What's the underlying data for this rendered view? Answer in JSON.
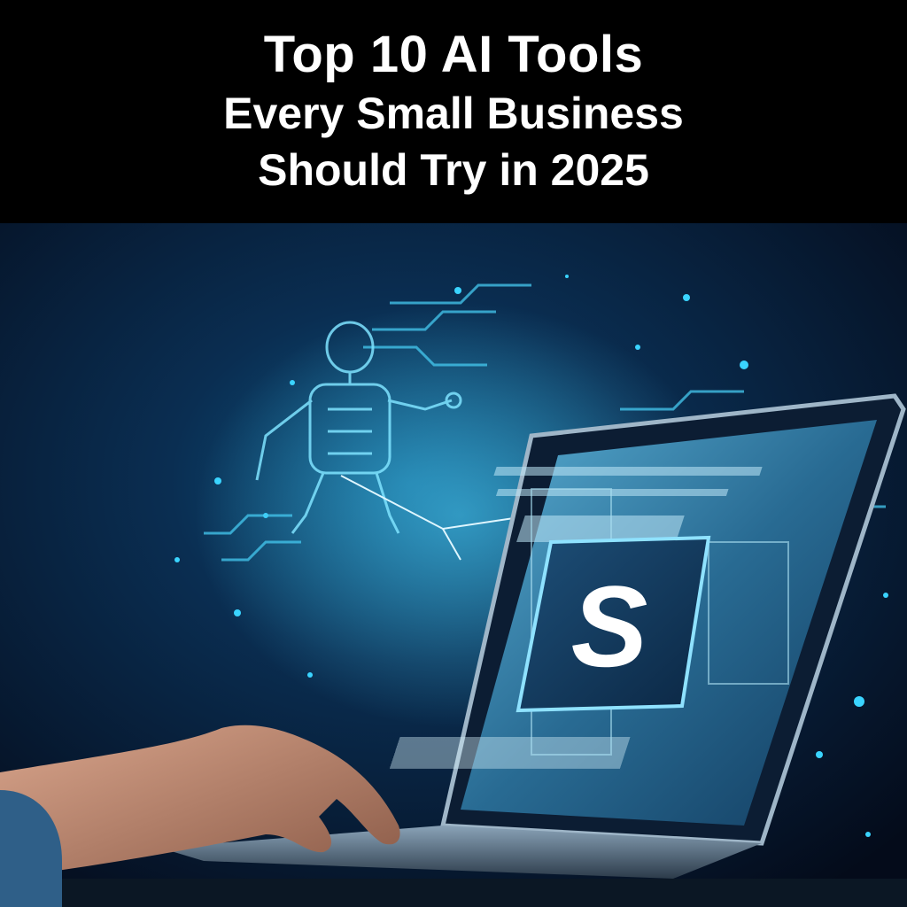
{
  "title": {
    "line1": "Top 10 AI Tools",
    "line2": "Every Small Business",
    "line3": "Should Try in 2025"
  },
  "hero": {
    "logo_glyph": "S"
  },
  "colors": {
    "banner_bg": "#000000",
    "title_text": "#ffffff",
    "hero_bg": "#06142a",
    "accent_cyan": "#3ad4ff",
    "screen_glow": "#7fd8f5"
  },
  "icons": [
    "robot-hologram-icon",
    "dollar-s-logo-icon",
    "laptop-icon",
    "hand-icon"
  ]
}
